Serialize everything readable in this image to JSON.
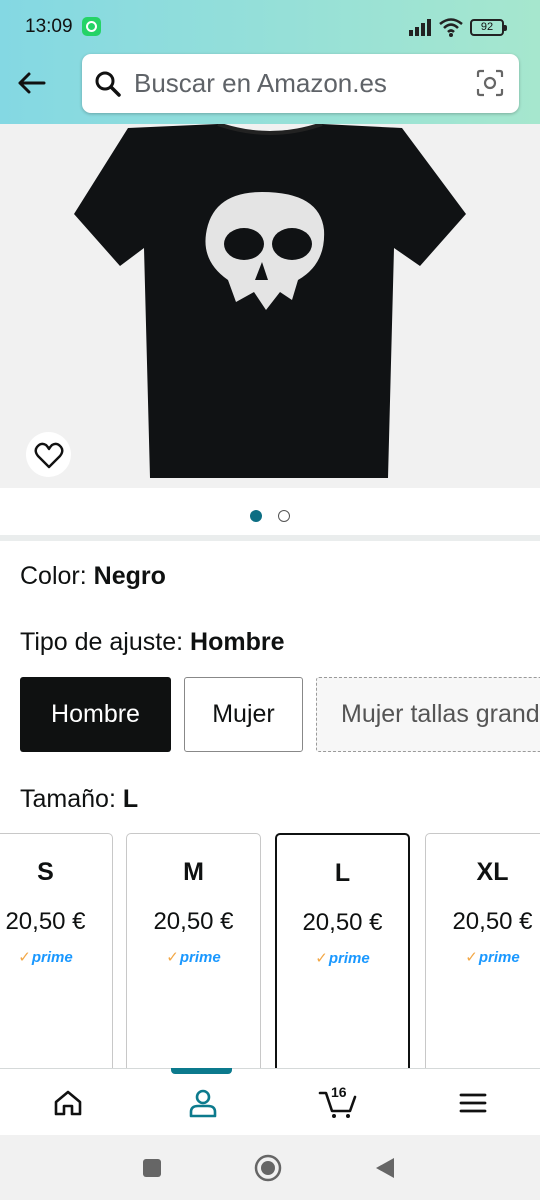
{
  "status_bar": {
    "time": "13:09",
    "battery": "92"
  },
  "search": {
    "placeholder": "Buscar en Amazon.es"
  },
  "product": {
    "color_label": "Color: ",
    "color_value": "Negro",
    "fit_label": "Tipo de ajuste: ",
    "fit_value": "Hombre",
    "fit_options": [
      "Hombre",
      "Mujer",
      "Mujer tallas grandes"
    ],
    "size_label": "Tamaño: ",
    "size_value": "L",
    "sizes": [
      {
        "name": "S",
        "price": "20,50 €",
        "prime": "prime"
      },
      {
        "name": "M",
        "price": "20,50 €",
        "prime": "prime"
      },
      {
        "name": "L",
        "price": "20,50 €",
        "prime": "prime"
      },
      {
        "name": "XL",
        "price": "20,50 €",
        "prime": "prime"
      }
    ],
    "image_count": 2,
    "image_index": 1
  },
  "bottom_nav": {
    "cart_count": "16"
  },
  "colors": {
    "accent": "#0c7a8d",
    "header_start": "#84d8e3",
    "header_end": "#a6e7ce",
    "prime_blue": "#1a98ff"
  }
}
